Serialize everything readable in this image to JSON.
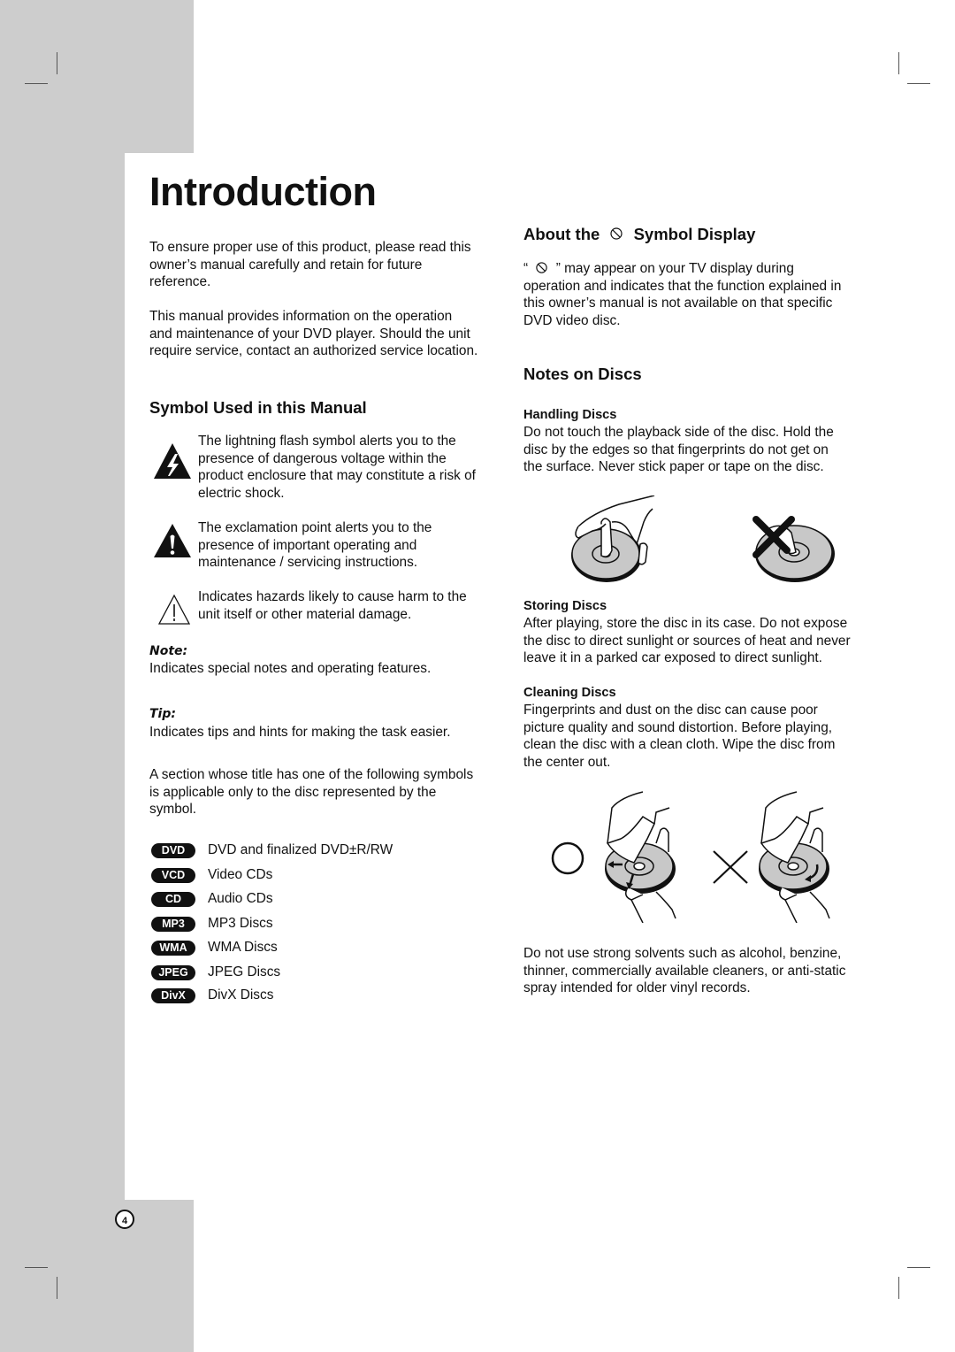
{
  "page": {
    "title": "Introduction",
    "page_number": "4"
  },
  "intro": {
    "para1": "To ensure proper use of this product, please read this owner’s manual carefully and retain for future reference.",
    "para1_lines": [
      "To ensure proper use of this product, please read this",
      "owner’s manual carefully and retain for future",
      "reference."
    ],
    "para2_lines": [
      "This manual provides information on the operation",
      "and maintenance of your DVD player. Should the unit",
      "require service, contact an authorized service location."
    ]
  },
  "symbols": {
    "heading": "Symbol Used in this Manual",
    "items": [
      {
        "icon": "lightning-warning-icon",
        "lines": [
          "The lightning flash symbol alerts you to the",
          "presence of dangerous voltage within the",
          "product enclosure that may constitute a risk of",
          "electric shock."
        ]
      },
      {
        "icon": "exclamation-warning-icon",
        "lines": [
          "The exclamation point alerts you to the",
          "presence of important operating and",
          "maintenance / servicing instructions."
        ]
      },
      {
        "icon": "caution-outline-icon",
        "lines": [
          "Indicates hazards likely to cause harm to the",
          "unit itself or other material damage."
        ]
      }
    ],
    "note_label": "Note:",
    "note_text": "Indicates special notes and operating features.",
    "tip_label": "Tip:",
    "tip_text": "Indicates tips and hints for making the task easier.",
    "section_lines": [
      "A section whose title has one of the following symbols",
      "is applicable only to the disc represented by the",
      "symbol."
    ],
    "discs": [
      {
        "badge": "DVD",
        "label": "DVD and finalized DVD±R/RW"
      },
      {
        "badge": "VCD",
        "label": "Video CDs"
      },
      {
        "badge": "CD",
        "label": "Audio CDs"
      },
      {
        "badge": "MP3",
        "label": "MP3 Discs"
      },
      {
        "badge": "WMA",
        "label": "WMA Discs"
      },
      {
        "badge": "JPEG",
        "label": "JPEG Discs"
      },
      {
        "badge": "DivX",
        "label": "DivX Discs"
      }
    ]
  },
  "about": {
    "heading_pre": "About the",
    "heading_post": "Symbol Display",
    "line1_pre": "“",
    "line1_post": "” may appear on your TV display during",
    "lines": [
      "operation and indicates that the function explained in",
      "this owner’s manual is not available on that specific",
      "DVD video disc."
    ]
  },
  "notes": {
    "heading": "Notes on Discs",
    "handling": {
      "heading": "Handling Discs",
      "lines": [
        "Do not touch the playback side of the disc. Hold the",
        "disc by the edges so that fingerprints do not get on",
        "the surface. Never stick paper or tape on the disc."
      ]
    },
    "storing": {
      "heading": "Storing Discs",
      "lines": [
        "After playing, store the disc in its case. Do not expose",
        "the disc to direct sunlight or sources of heat and never",
        "leave it in a parked car exposed to direct sunlight."
      ]
    },
    "cleaning": {
      "heading": "Cleaning Discs",
      "lines": [
        "Fingerprints and dust on the disc can cause poor",
        "picture quality and sound distortion. Before playing,",
        "clean the disc with a clean cloth. Wipe the disc from",
        "the center out."
      ]
    },
    "solvents_lines": [
      "Do not use strong solvents such as alcohol, benzine,",
      "thinner, commercially available cleaners, or anti-static",
      "spray intended for older vinyl records."
    ]
  }
}
